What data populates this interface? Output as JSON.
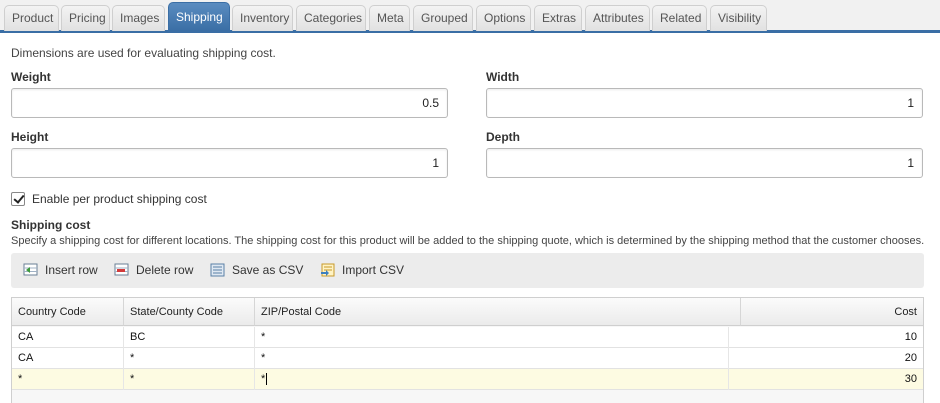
{
  "tabs": [
    {
      "label": "Product"
    },
    {
      "label": "Pricing"
    },
    {
      "label": "Images"
    },
    {
      "label": "Shipping"
    },
    {
      "label": "Inventory"
    },
    {
      "label": "Categories"
    },
    {
      "label": "Meta"
    },
    {
      "label": "Grouped"
    },
    {
      "label": "Options"
    },
    {
      "label": "Extras"
    },
    {
      "label": "Attributes"
    },
    {
      "label": "Related"
    },
    {
      "label": "Visibility"
    }
  ],
  "active_tab": "Shipping",
  "accent_color": "#3a6ea5",
  "intro_text": "Dimensions are used for evaluating shipping cost.",
  "fields": {
    "weight": {
      "label": "Weight",
      "value": "0.5"
    },
    "width": {
      "label": "Width",
      "value": "1"
    },
    "height": {
      "label": "Height",
      "value": "1"
    },
    "depth": {
      "label": "Depth",
      "value": "1"
    }
  },
  "per_product_checkbox": {
    "label": "Enable per product shipping cost",
    "checked": true
  },
  "shipping_cost": {
    "title": "Shipping cost",
    "description": "Specify a shipping cost for different locations. The shipping cost for this product will be added to the shipping quote, which is determined by the shipping method that the customer chooses."
  },
  "toolbar": {
    "insert_row": "Insert row",
    "delete_row": "Delete row",
    "save_csv": "Save as CSV",
    "import_csv": "Import CSV"
  },
  "table": {
    "columns": [
      "Country Code",
      "State/County Code",
      "ZIP/Postal Code",
      "Cost"
    ],
    "rows": [
      {
        "country": "CA",
        "state": "BC",
        "zip": "*",
        "cost": "10"
      },
      {
        "country": "CA",
        "state": "*",
        "zip": "*",
        "cost": "20"
      },
      {
        "country": "*",
        "state": "*",
        "zip": "*",
        "cost": "30"
      }
    ],
    "selected_row": 2
  }
}
